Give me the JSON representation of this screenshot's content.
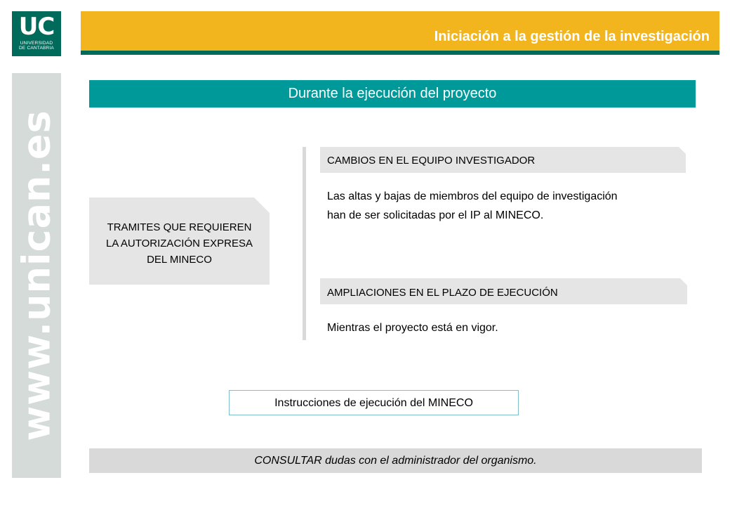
{
  "logo": {
    "mark": "UC",
    "line1": "UNIVERSIDAD",
    "line2": "DE CANTABRIA"
  },
  "header": {
    "title": "Iniciación a la gestión de la investigación"
  },
  "side": {
    "url": "www.unican.es"
  },
  "section": {
    "title": "Durante la ejecución del proyecto"
  },
  "left_box": {
    "text": "TRAMITES QUE REQUIEREN\nLA AUTORIZACIÓN EXPRESA\nDEL MINECO"
  },
  "items": [
    {
      "heading": "CAMBIOS EN EL EQUIPO INVESTIGADOR",
      "body": "Las altas y bajas de miembros del equipo de investigación\nhan de ser solicitadas por el IP al MINECO."
    },
    {
      "heading": "AMPLIACIONES EN EL PLAZO DE EJECUCIÓN",
      "body": "Mientras el proyecto está en vigor."
    }
  ],
  "instructions": {
    "label": "Instrucciones de ejecución del MINECO"
  },
  "consult": {
    "text": "CONSULTAR dudas con el administrador del organismo."
  },
  "colors": {
    "header_yellow": "#f2b51e",
    "brand_green": "#006b5b",
    "teal": "#009999",
    "side_gray": "#d4dbd8"
  }
}
